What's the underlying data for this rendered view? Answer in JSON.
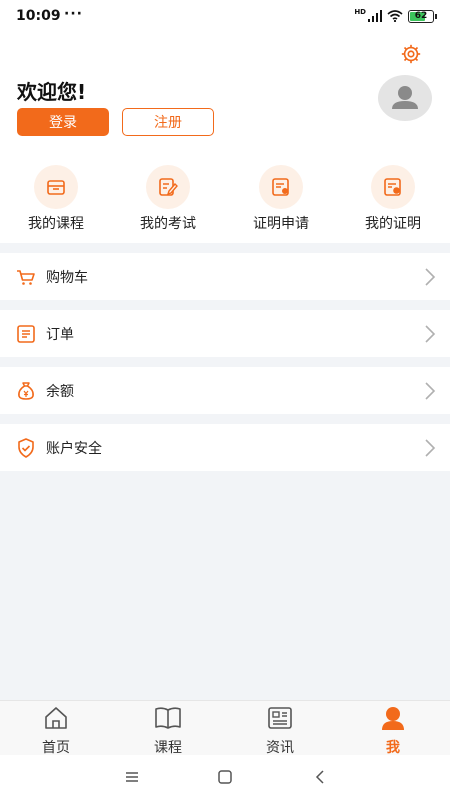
{
  "status_bar": {
    "time": "10:09",
    "dots": "···",
    "network": "HD",
    "battery": "62"
  },
  "header": {
    "welcome": "欢迎您!",
    "login_label": "登录",
    "register_label": "注册",
    "settings_icon": "gear-icon",
    "avatar_icon": "user-avatar-icon"
  },
  "quick_actions": [
    {
      "label": "我的课程",
      "icon": "course-box-icon"
    },
    {
      "label": "我的考试",
      "icon": "exam-edit-icon"
    },
    {
      "label": "证明申请",
      "icon": "certificate-apply-icon"
    },
    {
      "label": "我的证明",
      "icon": "my-certificate-icon"
    }
  ],
  "menu": [
    {
      "label": "购物车",
      "icon": "cart-icon"
    },
    {
      "label": "订单",
      "icon": "order-list-icon"
    },
    {
      "label": "余额",
      "icon": "money-bag-icon"
    },
    {
      "label": "账户安全",
      "icon": "shield-check-icon"
    }
  ],
  "tabs": [
    {
      "label": "首页",
      "icon": "home-icon",
      "active": false
    },
    {
      "label": "课程",
      "icon": "book-icon",
      "active": false
    },
    {
      "label": "资讯",
      "icon": "news-icon",
      "active": false
    },
    {
      "label": "我",
      "icon": "person-icon",
      "active": true
    }
  ],
  "colors": {
    "accent": "#f26a1b",
    "background": "#f2f4f7",
    "icon_bg": "#fdf0e6"
  }
}
